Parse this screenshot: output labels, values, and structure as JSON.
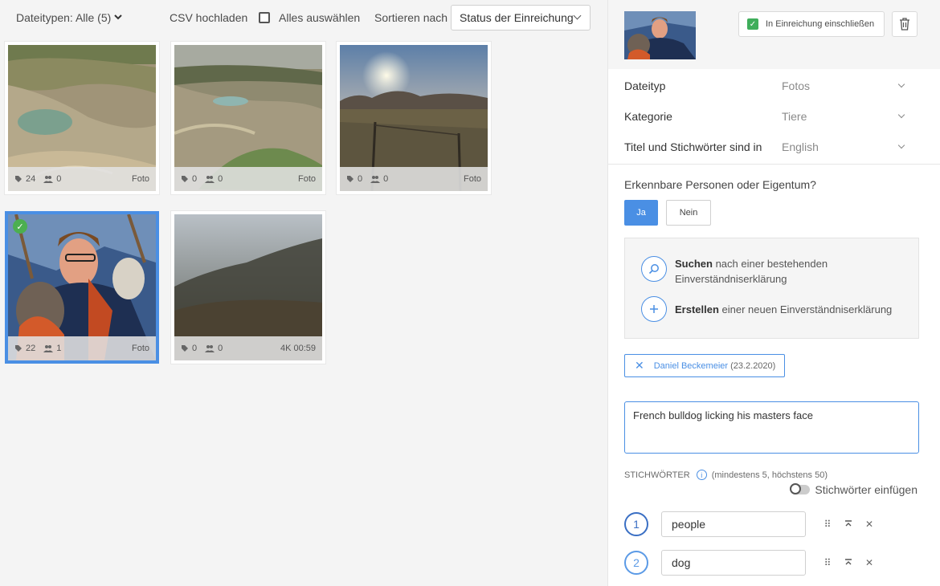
{
  "toolbar": {
    "filter_label": "Dateitypen: Alle (5)",
    "csv_label": "CSV hochladen",
    "select_all_label": "Alles auswählen",
    "sort_label": "Sortieren nach",
    "sort_value": "Status der Einreichung"
  },
  "tiles": [
    {
      "keywords": "24",
      "people": "0",
      "type": "Foto"
    },
    {
      "keywords": "0",
      "people": "0",
      "type": "Foto"
    },
    {
      "keywords": "0",
      "people": "0",
      "type": "Foto"
    },
    {
      "keywords": "22",
      "people": "1",
      "type": "Foto"
    },
    {
      "keywords": "0",
      "people": "0",
      "type": "4K 00:59"
    }
  ],
  "panel": {
    "include_label": "In Einreichung einschließen",
    "fields": [
      {
        "label": "Dateityp",
        "value": "Fotos"
      },
      {
        "label": "Kategorie",
        "value": "Tiere"
      },
      {
        "label": "Titel und Stichwörter sind in",
        "value": "English"
      }
    ],
    "question": "Erkennbare Personen oder Eigentum?",
    "yes_label": "Ja",
    "no_label": "Nein",
    "release": {
      "search_bold": "Suchen",
      "search_rest": " nach einer bestehenden Einverständniserklärung",
      "create_bold": "Erstellen",
      "create_rest": " einer neuen Einverständniserklärung"
    },
    "person_tag": {
      "name": "Daniel Beckemeier",
      "date": "(23.2.2020)"
    },
    "title_text": "French bulldog licking his masters face",
    "keywords_header": "STICHWÖRTER",
    "keywords_hint": "(mindestens 5, höchstens 50)",
    "toggle_label": "Stichwörter einfügen",
    "keywords": [
      {
        "num": "1",
        "text": "people"
      },
      {
        "num": "2",
        "text": "dog"
      }
    ]
  },
  "colors": {
    "accent": "#4a8fe4",
    "success": "#3fae5b"
  }
}
